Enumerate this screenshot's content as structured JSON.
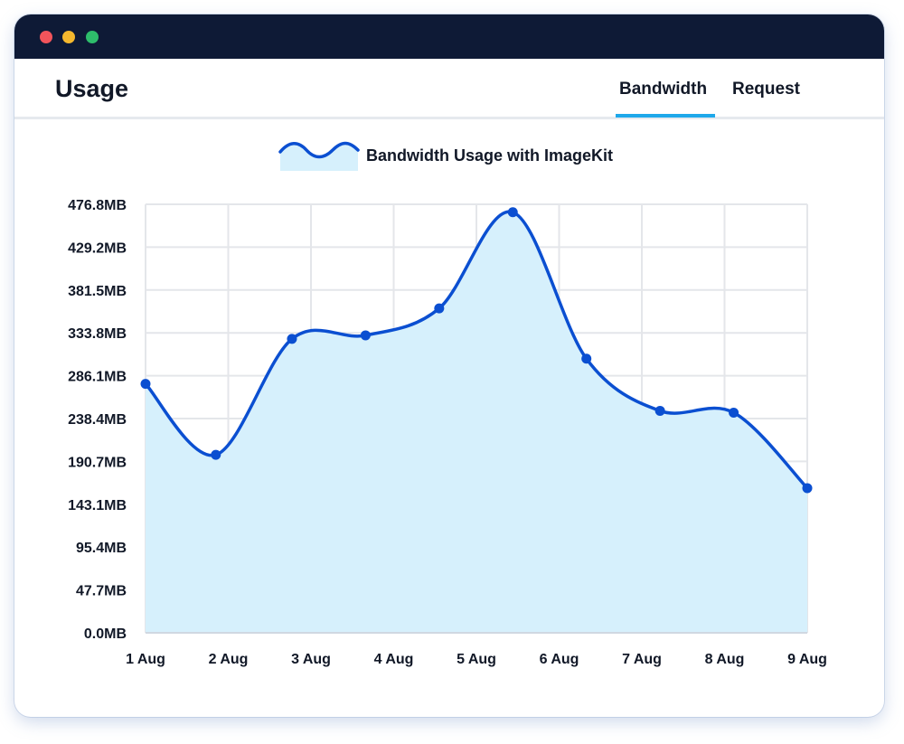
{
  "window": {
    "controls": [
      "close",
      "minimize",
      "maximize"
    ],
    "colors": {
      "titlebar": "#0e1a36",
      "close": "#f2545b",
      "minimize": "#f5b82e",
      "maximize": "#2ebd6b"
    }
  },
  "header": {
    "title": "Usage",
    "tabs": [
      {
        "label": "Bandwidth",
        "active": true
      },
      {
        "label": "Request",
        "active": false
      }
    ],
    "accent": "#1ea8ea"
  },
  "chart_data": {
    "type": "area",
    "title": "",
    "xlabel": "",
    "ylabel": "",
    "categories": [
      "1 Aug",
      "2 Aug",
      "3 Aug",
      "4 Aug",
      "5 Aug",
      "6 Aug",
      "7 Aug",
      "8 Aug",
      "9 Aug"
    ],
    "x_tick_labels": [
      "1 Aug",
      "2 Aug",
      "3 Aug",
      "4 Aug",
      "5 Aug",
      "6 Aug",
      "7 Aug",
      "8 Aug",
      "9 Aug"
    ],
    "y_tick_labels": [
      "0.0MB",
      "47.7MB",
      "95.4MB",
      "143.1MB",
      "190.7MB",
      "238.4MB",
      "286.1MB",
      "333.8MB",
      "381.5MB",
      "429.2MB",
      "476.8MB"
    ],
    "ylim": [
      0,
      476.8
    ],
    "grid": true,
    "legend_position": "top-center",
    "series": [
      {
        "name": "Bandwidth Usage with ImageKit",
        "color": "#0b4fd1",
        "fill": "#d6f0fc",
        "points": [
          {
            "x": 0.0,
            "y": 277
          },
          {
            "x": 0.85,
            "y": 198
          },
          {
            "x": 1.77,
            "y": 327
          },
          {
            "x": 2.66,
            "y": 331
          },
          {
            "x": 3.55,
            "y": 361
          },
          {
            "x": 4.44,
            "y": 468
          },
          {
            "x": 5.33,
            "y": 305
          },
          {
            "x": 6.22,
            "y": 247
          },
          {
            "x": 7.11,
            "y": 245
          },
          {
            "x": 8.0,
            "y": 161
          }
        ]
      }
    ]
  }
}
